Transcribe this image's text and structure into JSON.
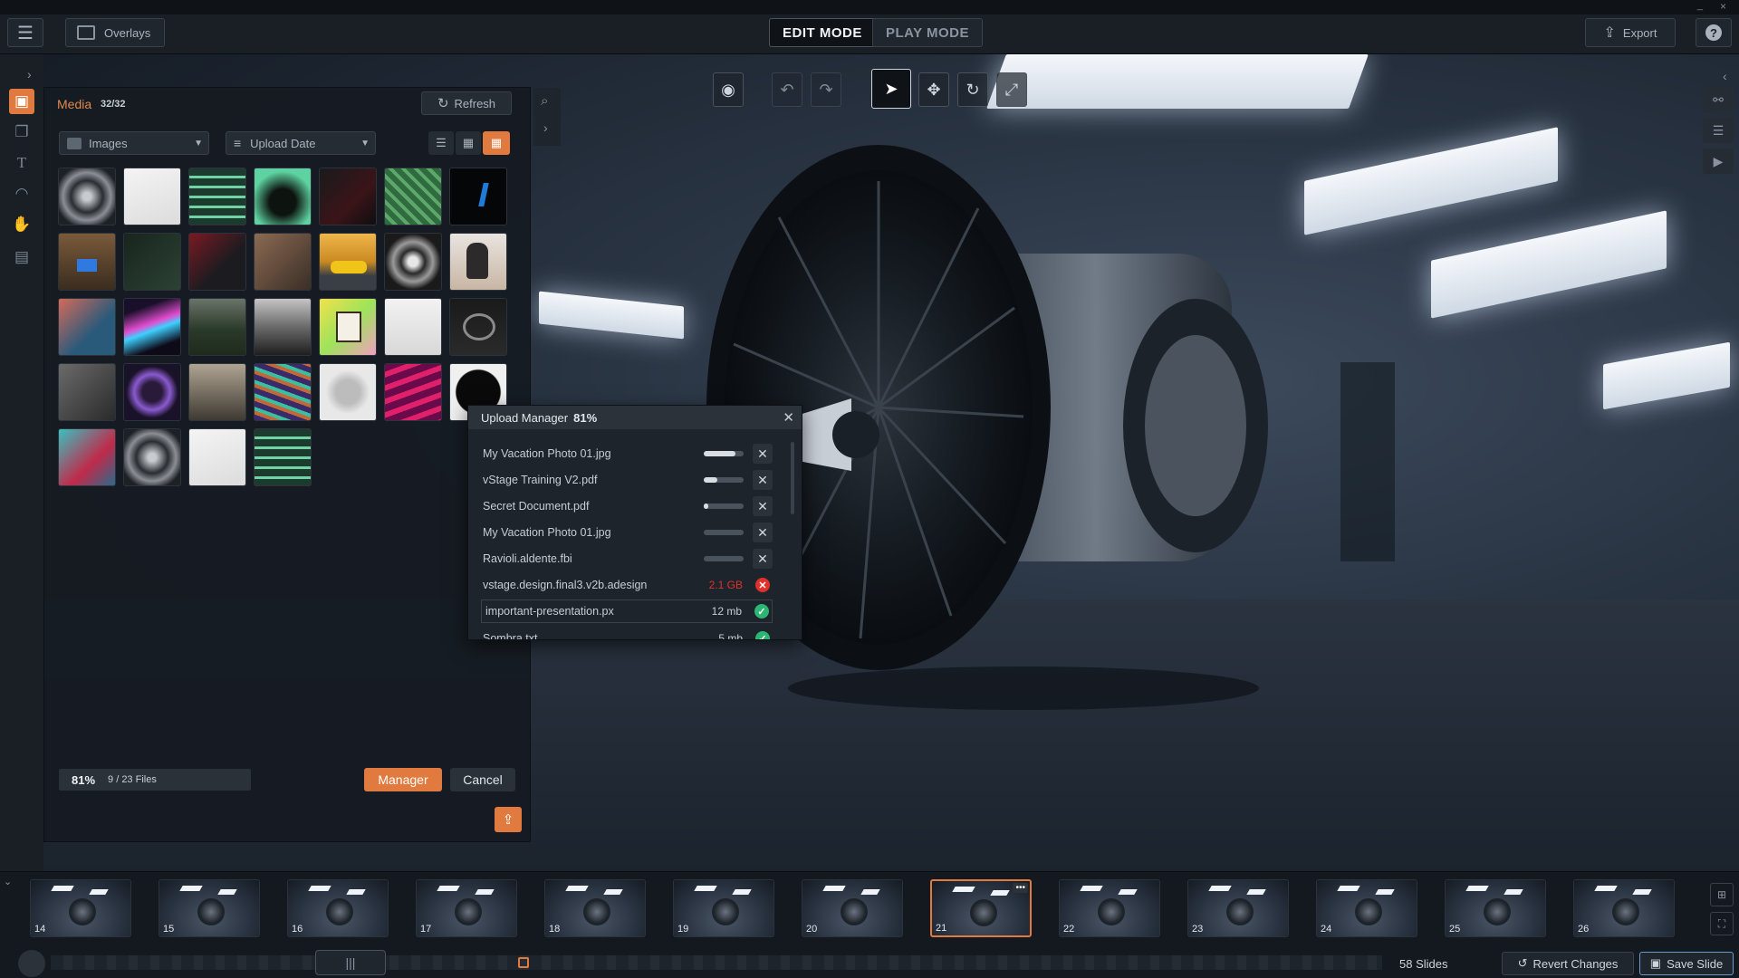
{
  "topbar": {
    "menu_icon": "hamburger-icon",
    "overlays_label": "Overlays",
    "edit_mode": "EDIT MODE",
    "play_mode": "PLAY MODE",
    "export_label": "Export",
    "help_icon": "question-icon",
    "window_controls": [
      "_",
      "☐",
      "×"
    ]
  },
  "media": {
    "title": "Media",
    "count": "32/32",
    "refresh_label": "Refresh",
    "filter_type": "Images",
    "sort_by": "Upload Date",
    "progress_percent": "81%",
    "files_status": "9 / 23 Files",
    "manager_label": "Manager",
    "cancel_label": "Cancel"
  },
  "upload_manager": {
    "title": "Upload Manager",
    "percent": "81%",
    "items": [
      {
        "name": "My Vacation Photo 01.jpg",
        "progress": 0.8,
        "state": "uploading"
      },
      {
        "name": "vStage Training V2.pdf",
        "progress": 0.35,
        "state": "uploading"
      },
      {
        "name": "Secret Document.pdf",
        "progress": 0.12,
        "state": "uploading"
      },
      {
        "name": "My Vacation Photo 01.jpg",
        "progress": 0,
        "state": "queued"
      },
      {
        "name": "Ravioli.aldente.fbi",
        "progress": 0,
        "state": "queued"
      },
      {
        "name": "vstage.design.final3.v2b.adesign",
        "size": "2.1 GB",
        "state": "error"
      },
      {
        "name": "important-presentation.px",
        "size": "12 mb",
        "state": "done"
      },
      {
        "name": "Sombra.txt",
        "size": "5 mb",
        "state": "done"
      }
    ]
  },
  "filmstrip": {
    "slides": [
      "14",
      "15",
      "16",
      "17",
      "18",
      "19",
      "20",
      "21",
      "22",
      "23",
      "24",
      "25",
      "26"
    ],
    "active_slide": "21",
    "slide_count": "58 Slides",
    "revert_label": "Revert Changes",
    "save_label": "Save Slide"
  },
  "colors": {
    "accent": "#e07a3f",
    "error": "#e0302a",
    "success": "#2bb673",
    "panel": "#161b22"
  }
}
